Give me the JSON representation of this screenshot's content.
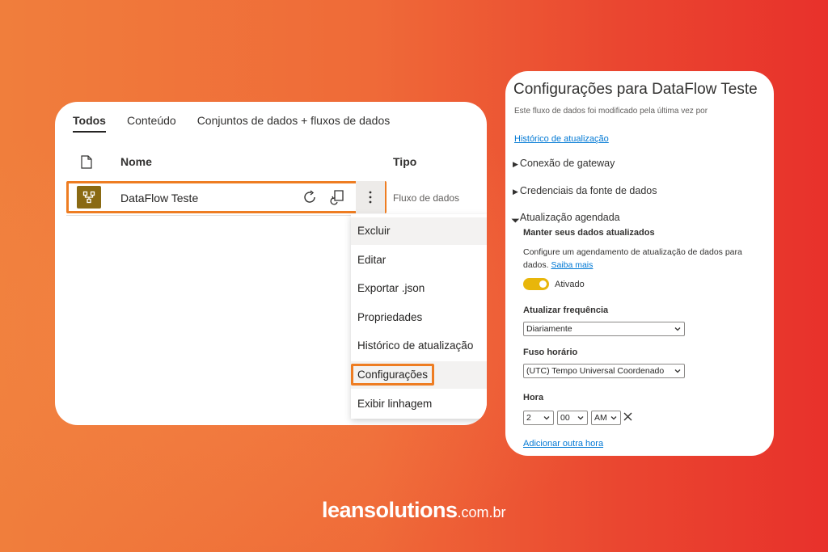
{
  "tabs": [
    "Todos",
    "Conteúdo",
    "Conjuntos de dados + fluxos de dados"
  ],
  "table": {
    "col_icon": "document-icon",
    "col_name": "Nome",
    "col_type": "Tipo",
    "row": {
      "icon": "dataflow-icon",
      "name": "DataFlow Teste",
      "type": "Fluxo de dados",
      "actions": [
        "refresh-icon",
        "schedule-refresh-icon",
        "more-options-icon"
      ]
    }
  },
  "context_menu": {
    "items": [
      "Excluir",
      "Editar",
      "Exportar .json",
      "Propriedades",
      "Histórico de atualização",
      "Configurações",
      "Exibir linhagem"
    ],
    "highlighted": "Configurações"
  },
  "settings": {
    "title": "Configurações para DataFlow Teste",
    "subtitle": "Este fluxo de dados foi modificado pela última vez por",
    "history_link": "Histórico de atualização",
    "sections": [
      "Conexão de gateway",
      "Credenciais da fonte de dados",
      "Atualização agendada"
    ],
    "keep_updated": "Manter seus dados atualizados",
    "description": "Configure um agendamento de atualização de dados para",
    "description_2": "dados.",
    "learn_more": "Saiba mais",
    "toggle_label": "Ativado",
    "toggle_on": true,
    "frequency_label": "Atualizar frequência",
    "frequency_value": "Diariamente",
    "timezone_label": "Fuso horário",
    "timezone_value": "(UTC) Tempo Universal Coordenado",
    "time_label": "Hora",
    "hour": "2",
    "minute": "00",
    "ampm": "AM",
    "add_time": "Adicionar outra hora"
  },
  "brand": {
    "name": "leansolutions",
    "domain": ".com.br"
  },
  "colors": {
    "highlight": "#ee7d22",
    "dataflow_icon_bg": "#8a6a13",
    "toggle": "#e8b60a",
    "link": "#0078d4"
  }
}
